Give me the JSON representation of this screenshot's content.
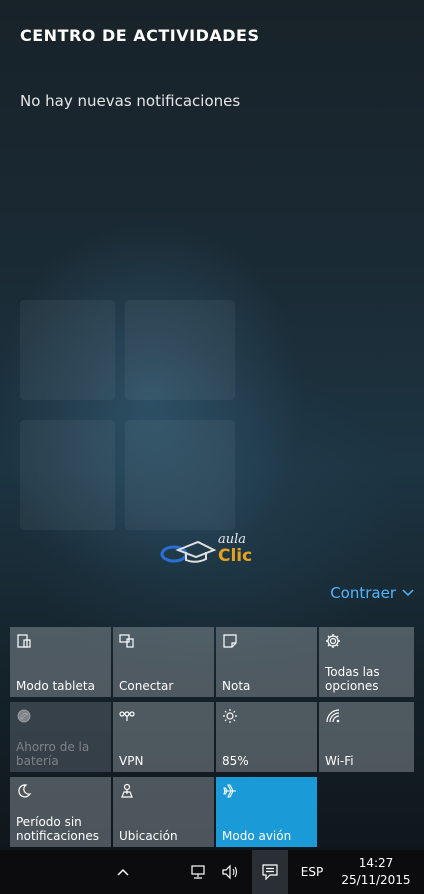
{
  "action_center": {
    "title": "CENTRO DE ACTIVIDADES",
    "empty_message": "No hay nuevas notificaciones",
    "collapse_label": "Contraer"
  },
  "watermark": {
    "small": "aula",
    "big": "Clic"
  },
  "quick_actions": [
    {
      "label": "Modo tableta",
      "icon": "tablet-mode-icon",
      "state": "disabled"
    },
    {
      "label": "Conectar",
      "icon": "connect-icon",
      "state": "normal"
    },
    {
      "label": "Nota",
      "icon": "note-icon",
      "state": "normal"
    },
    {
      "label": "Todas las opciones",
      "icon": "settings-gear-icon",
      "state": "normal"
    },
    {
      "label": "Ahorro de la batería",
      "icon": "battery-saver-icon",
      "state": "disabled"
    },
    {
      "label": "VPN",
      "icon": "vpn-icon",
      "state": "normal"
    },
    {
      "label": "85%",
      "icon": "brightness-icon",
      "state": "normal"
    },
    {
      "label": "Wi-Fi",
      "icon": "wifi-icon",
      "state": "normal"
    },
    {
      "label": "Período sin notificaciones",
      "icon": "quiet-hours-moon-icon",
      "state": "normal"
    },
    {
      "label": "Ubicación",
      "icon": "location-icon",
      "state": "normal"
    },
    {
      "label": "Modo avión",
      "icon": "airplane-icon",
      "state": "active"
    }
  ],
  "taskbar": {
    "language": "ESP",
    "time": "14:27",
    "date": "25/11/2015"
  },
  "colors": {
    "accent": "#1a9bd7",
    "link": "#4fb6ff",
    "tile": "#808890"
  }
}
